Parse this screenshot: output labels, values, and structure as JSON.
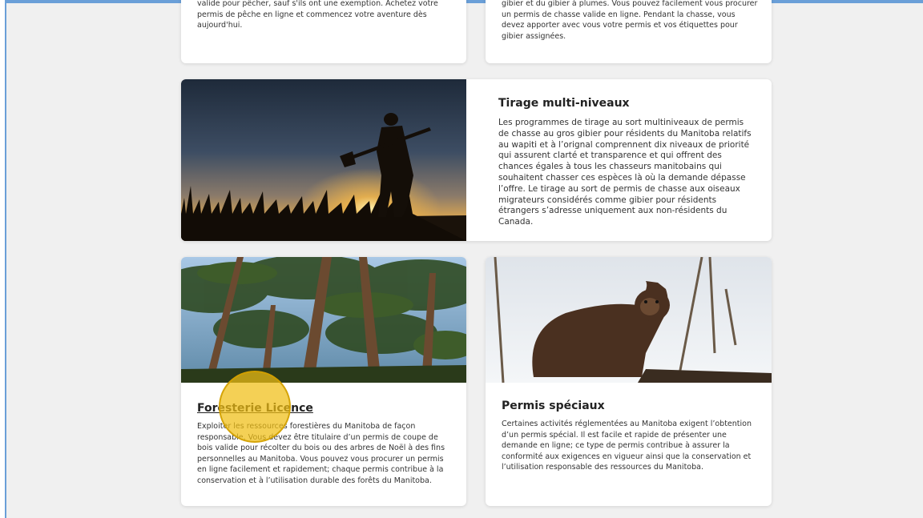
{
  "top_cards": {
    "fishing_text": "valide pour pêcher, sauf s'ils ont une exemption. Achetez votre permis de pêche en ligne et commencez votre aventure dès aujourd'hui.",
    "hunting_text": "gibier et du gibier à plumes. Vous pouvez facilement vous procurer un permis de chasse valide en ligne. Pendant la chasse, vous devez apporter avec vous votre permis et vos étiquettes pour gibier assignées."
  },
  "tirage": {
    "title": "Tirage multi-niveaux",
    "text": "Les programmes de tirage au sort multiniveaux de permis de chasse au gros gibier pour résidents du Manitoba relatifs au wapiti et à l’orignal comprennent dix niveaux de priorité qui assurent clarté et transparence et qui offrent des chances égales à tous les chasseurs manitobains qui souhaitent chasser ces espèces là où la demande dépasse l’offre. Le tirage au sort de permis de chasse aux oiseaux migrateurs considérés comme gibier pour résidents étrangers s’adresse uniquement aux non-résidents du Canada."
  },
  "forest": {
    "title": "Foresterie Licence",
    "text": "Exploiter les ressources forestières du Manitoba de façon responsable. Vous devez être titulaire d’un permis de coupe de bois valide pour récolter du bois ou des arbres de Noël à des fins personnelles au Manitoba. Vous pouvez vous procurer un permis en ligne facilement et rapidement; chaque permis contribue à la conservation et à l’utilisation durable des forêts du Manitoba."
  },
  "special": {
    "title": "Permis spéciaux",
    "text": "Certaines activités réglementées au Manitoba exigent l’obtention d’un permis spécial. Il est facile et rapide de présenter une demande en ligne; ce type de permis contribue à assurer la conformité aux exigences en vigueur ainsi que la conservation et l’utilisation responsable des ressources du Manitoba."
  },
  "colors": {
    "highlight": "#f0be14",
    "frame": "#6a9fd8"
  }
}
